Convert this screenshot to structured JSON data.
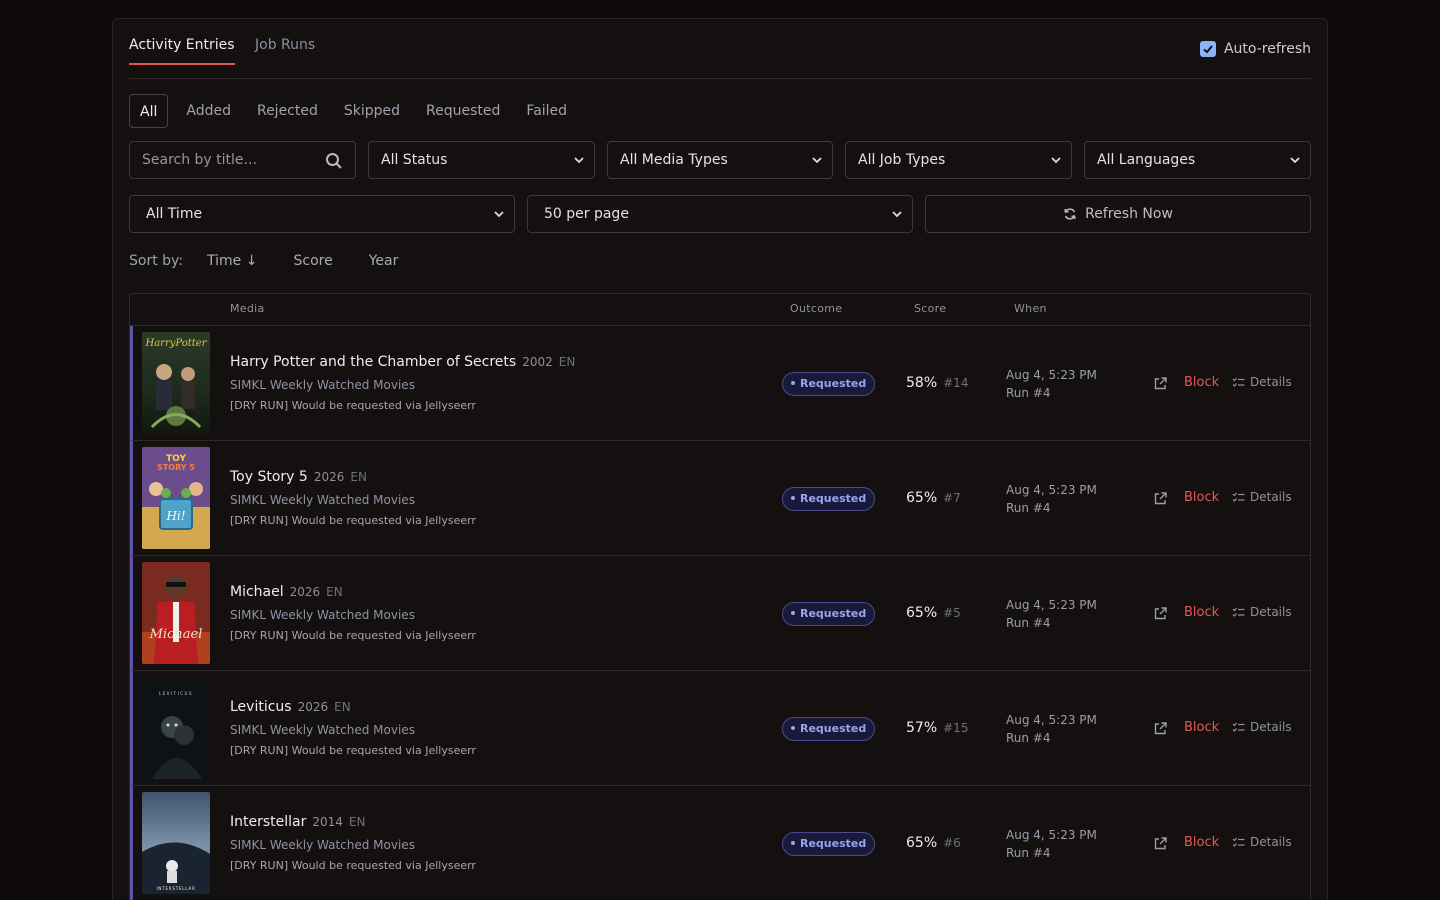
{
  "tabs": [
    {
      "label": "Activity Entries",
      "active": true
    },
    {
      "label": "Job Runs",
      "active": false
    }
  ],
  "auto_refresh": {
    "label": "Auto-refresh",
    "checked": true
  },
  "status_filters": [
    {
      "label": "All",
      "active": true
    },
    {
      "label": "Added"
    },
    {
      "label": "Rejected"
    },
    {
      "label": "Skipped"
    },
    {
      "label": "Requested"
    },
    {
      "label": "Failed"
    }
  ],
  "search": {
    "placeholder": "Search by title..."
  },
  "selects": {
    "status": "All Status",
    "media_types": "All Media Types",
    "job_types": "All Job Types",
    "languages": "All Languages",
    "time": "All Time",
    "per_page": "50 per page"
  },
  "refresh_button": "Refresh Now",
  "sort": {
    "label": "Sort by:",
    "options": [
      "Time ↓",
      "Score",
      "Year"
    ]
  },
  "columns": {
    "media": "Media",
    "outcome": "Outcome",
    "score": "Score",
    "when": "When"
  },
  "actions": {
    "block": "Block",
    "details": "Details"
  },
  "colors": {
    "accent": "#e0524a",
    "badge": "#9aa4ee",
    "block": "#e25a55",
    "row_marker": "#5b54a8"
  },
  "entries": [
    {
      "title": "Harry Potter and the Chamber of Secrets",
      "year": "2002",
      "lang": "EN",
      "source": "SIMKL Weekly Watched Movies",
      "note": "[DRY RUN] Would be requested via Jellyseerr",
      "outcome": "Requested",
      "score": "58%",
      "rank": "#14",
      "when": "Aug 4, 5:23 PM",
      "run": "Run #4"
    },
    {
      "title": "Toy Story 5",
      "year": "2026",
      "lang": "EN",
      "source": "SIMKL Weekly Watched Movies",
      "note": "[DRY RUN] Would be requested via Jellyseerr",
      "outcome": "Requested",
      "score": "65%",
      "rank": "#7",
      "when": "Aug 4, 5:23 PM",
      "run": "Run #4"
    },
    {
      "title": "Michael",
      "year": "2026",
      "lang": "EN",
      "source": "SIMKL Weekly Watched Movies",
      "note": "[DRY RUN] Would be requested via Jellyseerr",
      "outcome": "Requested",
      "score": "65%",
      "rank": "#5",
      "when": "Aug 4, 5:23 PM",
      "run": "Run #4"
    },
    {
      "title": "Leviticus",
      "year": "2026",
      "lang": "EN",
      "source": "SIMKL Weekly Watched Movies",
      "note": "[DRY RUN] Would be requested via Jellyseerr",
      "outcome": "Requested",
      "score": "57%",
      "rank": "#15",
      "when": "Aug 4, 5:23 PM",
      "run": "Run #4"
    },
    {
      "title": "Interstellar",
      "year": "2014",
      "lang": "EN",
      "source": "SIMKL Weekly Watched Movies",
      "note": "[DRY RUN] Would be requested via Jellyseerr",
      "outcome": "Requested",
      "score": "65%",
      "rank": "#6",
      "when": "Aug 4, 5:23 PM",
      "run": "Run #4"
    }
  ]
}
